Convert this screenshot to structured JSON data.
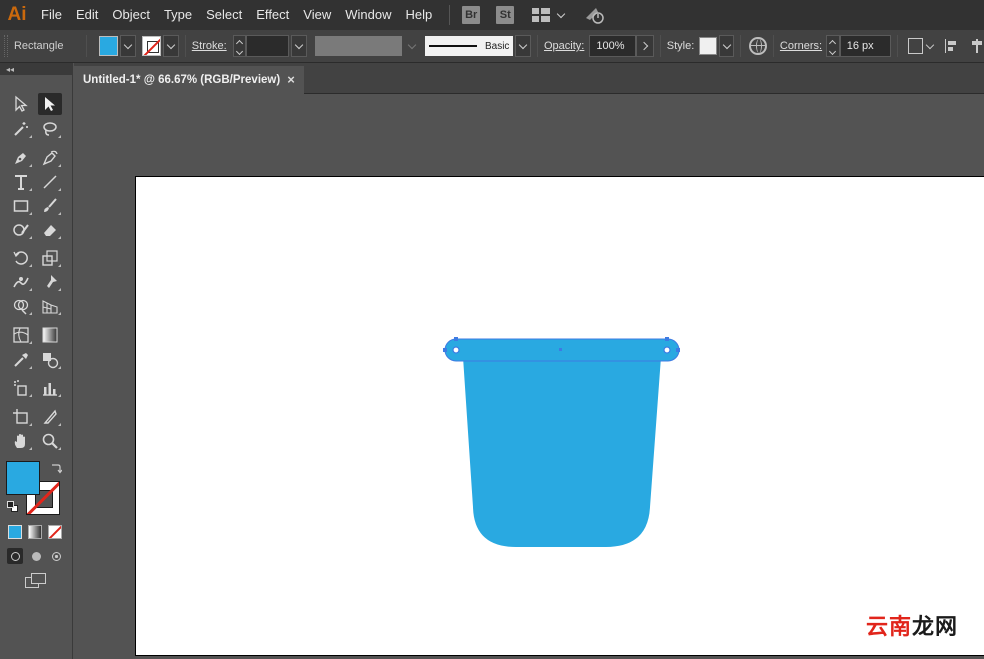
{
  "app": {
    "logo": "Ai"
  },
  "menu": [
    "File",
    "Edit",
    "Object",
    "Type",
    "Select",
    "Effect",
    "View",
    "Window",
    "Help"
  ],
  "menu_badges": [
    "Br",
    "St"
  ],
  "control": {
    "tool_name": "Rectangle",
    "stroke_label": "Stroke:",
    "stroke_value": "",
    "brush_label": "Basic",
    "opacity_label": "Opacity:",
    "opacity_value": "100%",
    "style_label": "Style:",
    "corners_label": "Corners:",
    "corners_value": "16 px",
    "fill_color": "#29A9E1"
  },
  "document": {
    "tab_title": "Untitled-1* @ 66.67% (RGB/Preview)",
    "close_glyph": "×"
  },
  "artwork": {
    "shape_color": "#29A9E1",
    "selection_color": "#3D7BE3"
  },
  "watermark": {
    "part1": "云南",
    "part2": "龙网"
  }
}
